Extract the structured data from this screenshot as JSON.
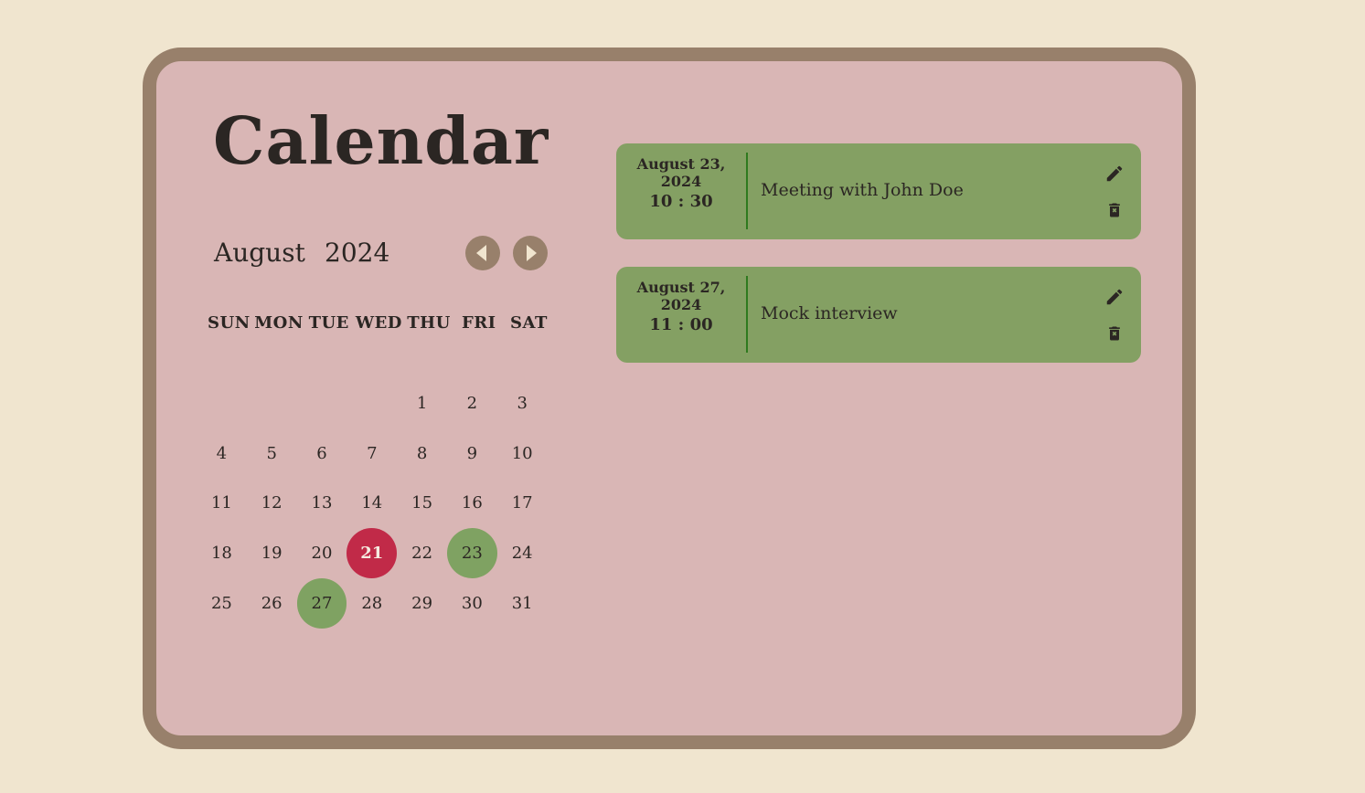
{
  "title": "Calendar",
  "month_nav": {
    "month": "August",
    "year": "2024",
    "prev_icon": "chevron-left-icon",
    "next_icon": "chevron-right-icon"
  },
  "weekdays": [
    "SUN",
    "MON",
    "TUE",
    "WED",
    "THU",
    "FRI",
    "SAT"
  ],
  "days": {
    "leading_blanks": 4,
    "count": 31,
    "today": 21,
    "event_days": [
      23,
      27
    ]
  },
  "events": [
    {
      "date": "August 23, 2024",
      "time": "10 : 30",
      "text": "Meeting with John Doe",
      "edit_icon": "pencil-icon",
      "delete_icon": "trash-icon"
    },
    {
      "date": "August 27, 2024",
      "time": "11 : 00",
      "text": "Mock interview",
      "edit_icon": "pencil-icon",
      "delete_icon": "trash-icon"
    }
  ],
  "colors": {
    "page_background": "#f0e5cf",
    "frame_border": "#98806b",
    "panel_background": "#d9b6b5",
    "today_highlight": "#c12a48",
    "event_highlight": "#7fa262",
    "event_card": "#84a063",
    "text": "#2b2623"
  }
}
